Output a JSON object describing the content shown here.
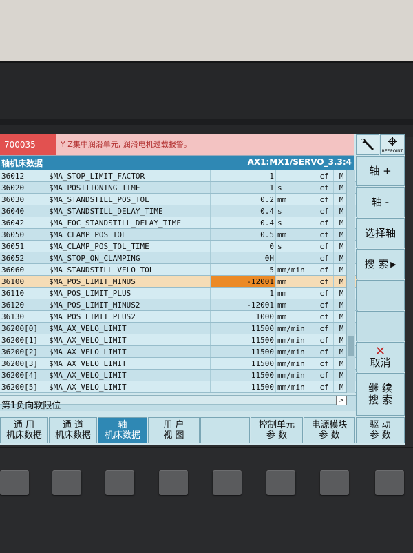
{
  "alarm": {
    "number": "700035",
    "text": "Y Z集中润滑单元, 润滑电机过载报警。"
  },
  "header": {
    "title": "轴机床数据",
    "axis_path": "AX1:MX1/SERVO_3.3:4"
  },
  "rows": [
    {
      "no": "36012",
      "name": "$MA_STOP_LIMIT_FACTOR",
      "value": "1",
      "unit": "",
      "cf": "cf",
      "m": "M"
    },
    {
      "no": "36020",
      "name": "$MA_POSITIONING_TIME",
      "value": "1",
      "unit": "s",
      "cf": "cf",
      "m": "M"
    },
    {
      "no": "36030",
      "name": "$MA_STANDSTILL_POS_TOL",
      "value": "0.2",
      "unit": "mm",
      "cf": "cf",
      "m": "M"
    },
    {
      "no": "36040",
      "name": "$MA_STANDSTILL_DELAY_TIME",
      "value": "0.4",
      "unit": "s",
      "cf": "cf",
      "m": "M"
    },
    {
      "no": "36042",
      "name": "$MA_FOC_STANDSTILL_DELAY_TIME",
      "value": "0.4",
      "unit": "s",
      "cf": "cf",
      "m": "M"
    },
    {
      "no": "36050",
      "name": "$MA_CLAMP_POS_TOL",
      "value": "0.5",
      "unit": "mm",
      "cf": "cf",
      "m": "M"
    },
    {
      "no": "36051",
      "name": "$MA_CLAMP_POS_TOL_TIME",
      "value": "0",
      "unit": "s",
      "cf": "cf",
      "m": "M"
    },
    {
      "no": "36052",
      "name": "$MA_STOP_ON_CLAMPING",
      "value": "0H",
      "unit": "",
      "cf": "cf",
      "m": "M"
    },
    {
      "no": "36060",
      "name": "$MA_STANDSTILL_VELO_TOL",
      "value": "5",
      "unit": "mm/min",
      "cf": "cf",
      "m": "M"
    },
    {
      "no": "36100",
      "name": "$MA_POS_LIMIT_MINUS",
      "value": "-12001",
      "unit": "mm",
      "cf": "cf",
      "m": "M",
      "selected": true
    },
    {
      "no": "36110",
      "name": "$MA_POS_LIMIT_PLUS",
      "value": "1",
      "unit": "mm",
      "cf": "cf",
      "m": "M"
    },
    {
      "no": "36120",
      "name": "$MA_POS_LIMIT_MINUS2",
      "value": "-12001",
      "unit": "mm",
      "cf": "cf",
      "m": "M"
    },
    {
      "no": "36130",
      "name": "$MA_POS_LIMIT_PLUS2",
      "value": "1000",
      "unit": "mm",
      "cf": "cf",
      "m": "M"
    },
    {
      "no": "36200[0]",
      "name": "$MA_AX_VELO_LIMIT",
      "value": "11500",
      "unit": "mm/min",
      "cf": "cf",
      "m": "M"
    },
    {
      "no": "36200[1]",
      "name": "$MA_AX_VELO_LIMIT",
      "value": "11500",
      "unit": "mm/min",
      "cf": "cf",
      "m": "M"
    },
    {
      "no": "36200[2]",
      "name": "$MA_AX_VELO_LIMIT",
      "value": "11500",
      "unit": "mm/min",
      "cf": "cf",
      "m": "M"
    },
    {
      "no": "36200[3]",
      "name": "$MA_AX_VELO_LIMIT",
      "value": "11500",
      "unit": "mm/min",
      "cf": "cf",
      "m": "M"
    },
    {
      "no": "36200[4]",
      "name": "$MA_AX_VELO_LIMIT",
      "value": "11500",
      "unit": "mm/min",
      "cf": "cf",
      "m": "M"
    },
    {
      "no": "36200[5]",
      "name": "$MA_AX_VELO_LIMIT",
      "value": "11500",
      "unit": "mm/min",
      "cf": "cf",
      "m": "M"
    }
  ],
  "status_text": "第1负向软限位",
  "right_keys": {
    "ref_point": "REF.POINT",
    "axis_plus": "轴 +",
    "axis_minus": "轴 -",
    "select_axis": "选择轴",
    "search": "搜 索",
    "cancel": "取消",
    "continue_search_1": "继 续",
    "continue_search_2": "搜 索"
  },
  "bottom_keys": {
    "general_1": "通 用",
    "general_2": "机床数据",
    "channel_1": "通 道",
    "channel_2": "机床数据",
    "axis_1": "轴",
    "axis_2": "机床数据",
    "user_1": "用 户",
    "user_2": "视 图",
    "cu_1": "控制单元",
    "cu_2": "参 数",
    "psm_1": "电源模块",
    "psm_2": "参 数",
    "drive_1": "驱 动",
    "drive_2": "参 数"
  },
  "colors": {
    "alarm_red": "#e25150",
    "header_blue": "#2f88b4",
    "selected_orange": "#ec8a26",
    "screen_bg": "#cfe6ec"
  }
}
